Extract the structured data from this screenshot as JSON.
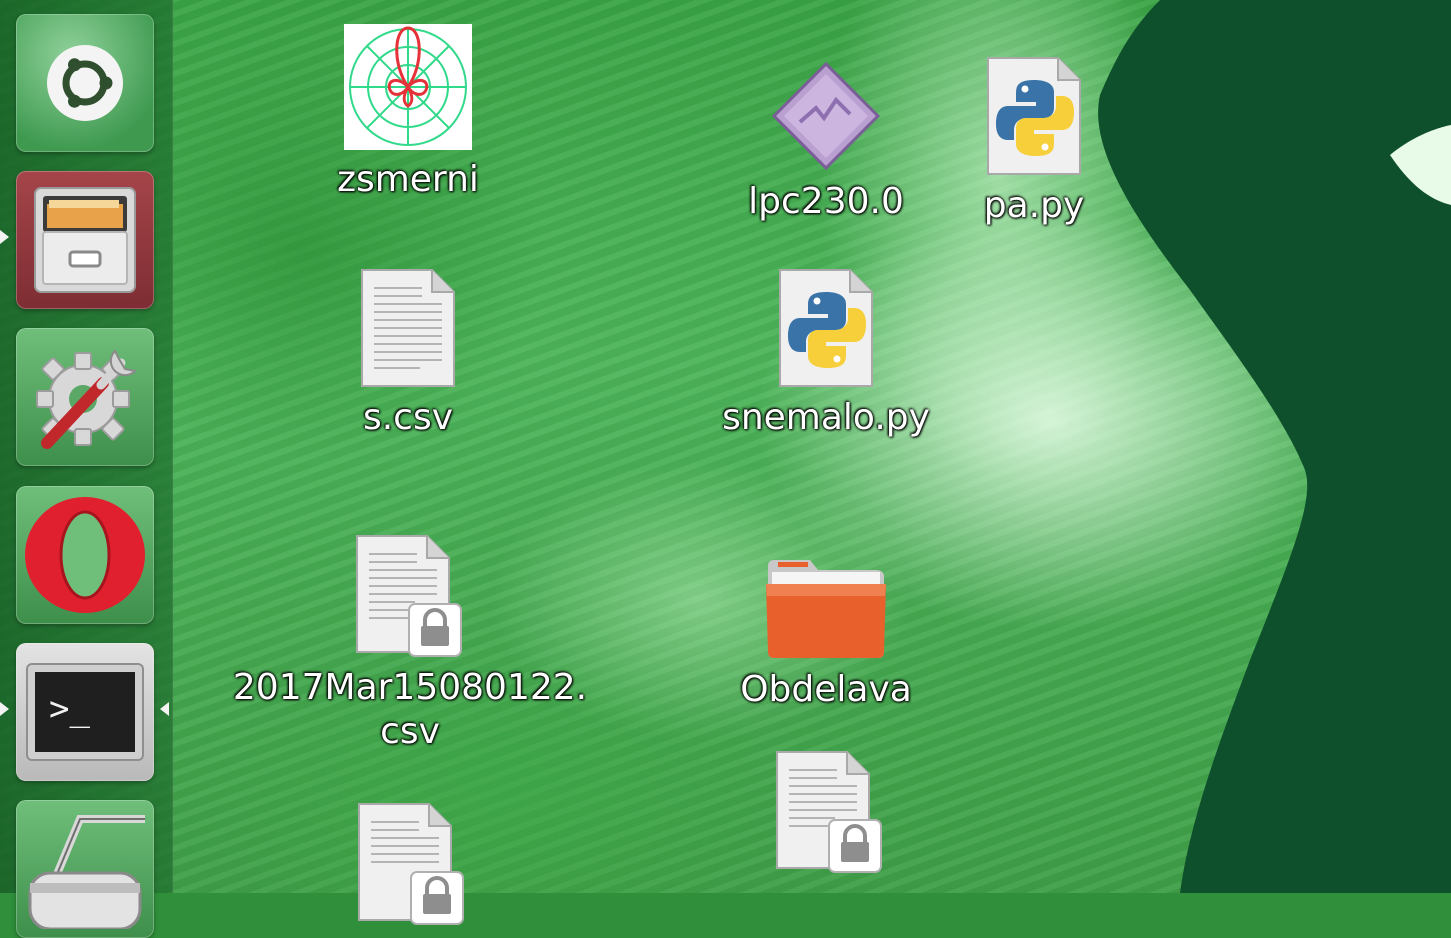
{
  "launcher": {
    "items": [
      {
        "name": "ubuntu-dash",
        "icon": "ubuntu-logo-icon"
      },
      {
        "name": "files",
        "icon": "file-cabinet-icon"
      },
      {
        "name": "system-settings",
        "icon": "settings-gear-wrench-icon"
      },
      {
        "name": "opera-browser",
        "icon": "opera-icon"
      },
      {
        "name": "terminal",
        "icon": "terminal-icon"
      },
      {
        "name": "roller-app",
        "icon": "roller-icon"
      }
    ],
    "terminal_prompt": ">_"
  },
  "desktop": {
    "icons": [
      {
        "label": "zsmerni",
        "icon": "polar-plot-image-icon"
      },
      {
        "label": "lpc230.0",
        "icon": "diamond-file-icon"
      },
      {
        "label": "pa.py",
        "icon": "python-file-icon"
      },
      {
        "label": "s.csv",
        "icon": "text-file-icon"
      },
      {
        "label": "snemalo.py",
        "icon": "python-file-icon"
      },
      {
        "label_line1": "2017Mar15080122.",
        "label_line2": "csv",
        "icon": "locked-text-file-icon"
      },
      {
        "label": "Obdelava",
        "icon": "folder-icon"
      },
      {
        "label": "",
        "icon": "locked-text-file-icon"
      },
      {
        "label": "",
        "icon": "locked-text-file-icon"
      }
    ]
  },
  "colors": {
    "launcher_bg": "#1e6e2d",
    "folder_orange": "#e8612c",
    "opera_red": "#e0202e",
    "python_blue": "#3a73a8",
    "python_yellow": "#f7cf3a"
  }
}
